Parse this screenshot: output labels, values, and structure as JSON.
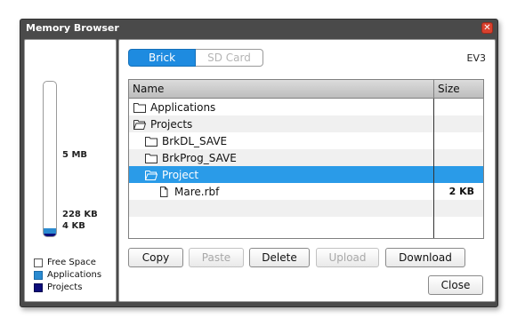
{
  "window": {
    "title": "Memory Browser"
  },
  "gauge": {
    "labels": [
      "5 MB",
      "228 KB",
      "4 KB"
    ],
    "applications_fraction": 0.05,
    "projects_fraction": 0.02
  },
  "legend": [
    "Free Space",
    "Applications",
    "Projects"
  ],
  "tabs": {
    "brick": "Brick",
    "sd_card": "SD Card",
    "selected": "Brick"
  },
  "device_label": "EV3",
  "table": {
    "columns": [
      "Name",
      "Size"
    ],
    "rows": [
      {
        "name": "Applications",
        "size": "",
        "icon": "folder-closed-icon"
      },
      {
        "name": "Projects",
        "size": "",
        "icon": "folder-open-icon"
      },
      {
        "name": "BrkDL_SAVE",
        "size": "",
        "icon": "folder-closed-icon"
      },
      {
        "name": "BrkProg_SAVE",
        "size": "",
        "icon": "folder-closed-icon"
      },
      {
        "name": "Project",
        "size": "",
        "icon": "folder-open-icon",
        "selected": true
      },
      {
        "name": "Mare.rbf",
        "size": "2 KB",
        "icon": "file-icon"
      }
    ]
  },
  "buttons": {
    "copy": "Copy",
    "paste": "Paste",
    "delete": "Delete",
    "upload": "Upload",
    "download": "Download",
    "close": "Close"
  },
  "colors": {
    "accent": "#1e8be0",
    "selection": "#2a9be8",
    "applications": "#2a8ad0",
    "projects": "#0d0d7a",
    "close_button": "#d9412e"
  }
}
